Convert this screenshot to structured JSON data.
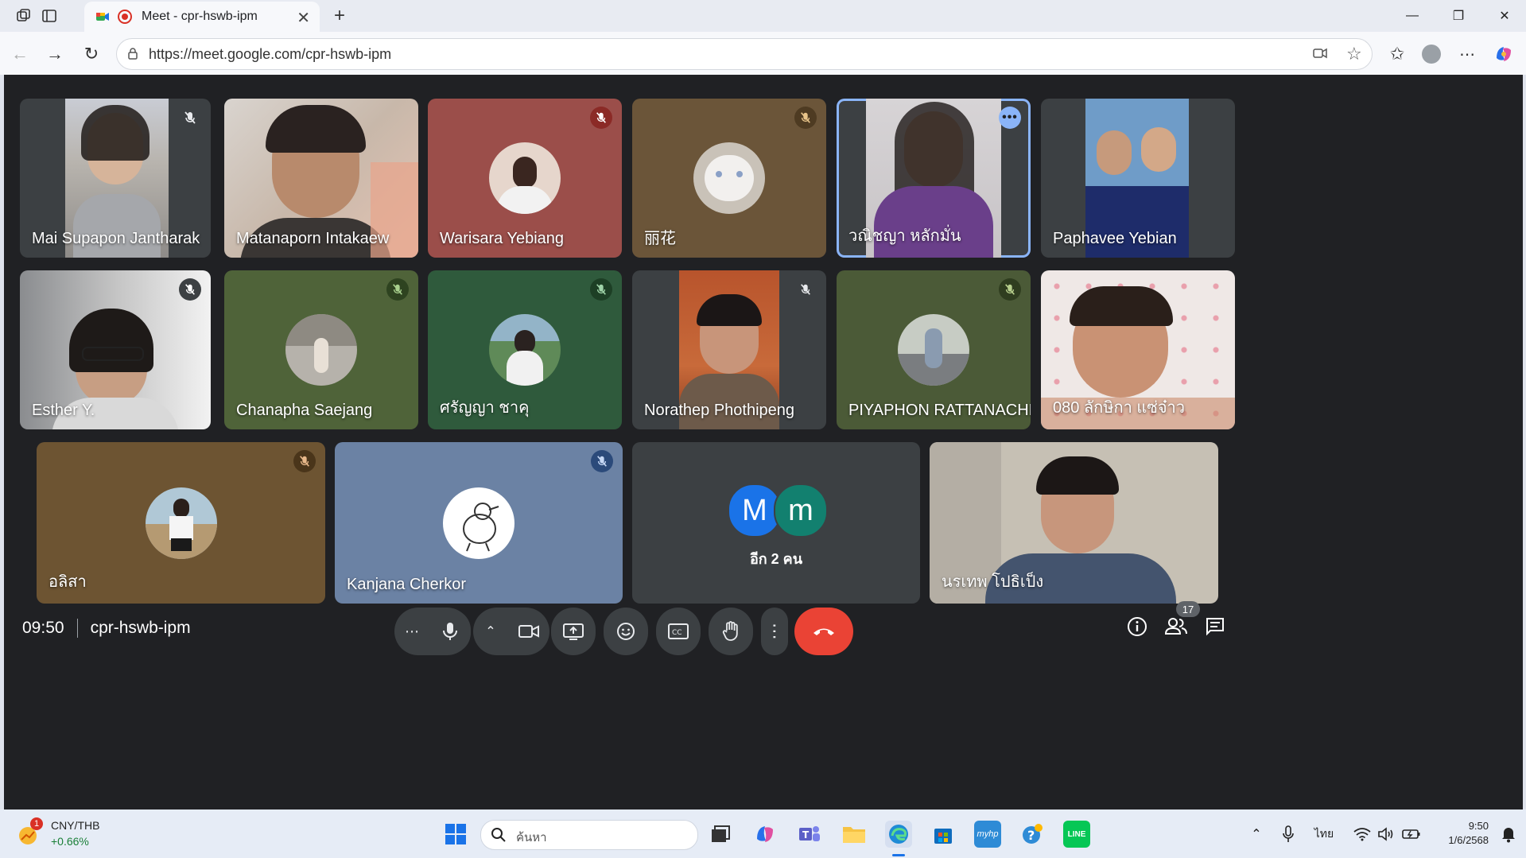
{
  "browser": {
    "tab_title": "Meet - cpr-hswb-ipm",
    "url": "https://meet.google.com/cpr-hswb-ipm",
    "new_tab": "+"
  },
  "tiles": [
    {
      "name": "Mai Supapon Jantharak",
      "mic": "muted"
    },
    {
      "name": "Matanaporn Intakaew",
      "mic": ""
    },
    {
      "name": "Warisara Yebiang",
      "mic": "muted"
    },
    {
      "name": "丽花",
      "mic": "muted"
    },
    {
      "name": "วณิชญา หลักมั่น",
      "mic": "more"
    },
    {
      "name": "Paphavee Yebian",
      "mic": ""
    },
    {
      "name": "Esther Y.",
      "mic": "muted"
    },
    {
      "name": "Chanapha Saejang",
      "mic": "muted"
    },
    {
      "name": "ศรัญญา ชาคุ",
      "mic": "muted"
    },
    {
      "name": "Norathep Phothipeng",
      "mic": "muted"
    },
    {
      "name": "PIYAPHON RATTANACHM...",
      "mic": "muted"
    },
    {
      "name": "080 ลักษิกา แซ่จ๋าว",
      "mic": ""
    },
    {
      "name": "อลิสา",
      "mic": "muted"
    },
    {
      "name": "Kanjana Cherkor",
      "mic": "muted"
    },
    {
      "name": "นรเทพ โปธิเป็ง",
      "mic": ""
    }
  ],
  "others": {
    "label": "อีก 2 คน",
    "avatar1": "M",
    "avatar2": "m"
  },
  "footer": {
    "time": "09:50",
    "meeting_code": "cpr-hswb-ipm",
    "participant_count": "17"
  },
  "taskbar": {
    "widget_ticker": "CNY/THB",
    "widget_change": "+0.66%",
    "widget_badge": "1",
    "search_placeholder": "ค้นหา",
    "lang": "ไทย",
    "clock_time": "9:50",
    "clock_date": "1/6/2568"
  },
  "colors": {
    "end_call": "#ea4335",
    "meet_bg": "#202124",
    "control_bg": "#3c4043",
    "speaking_border": "#8ab4f8"
  }
}
